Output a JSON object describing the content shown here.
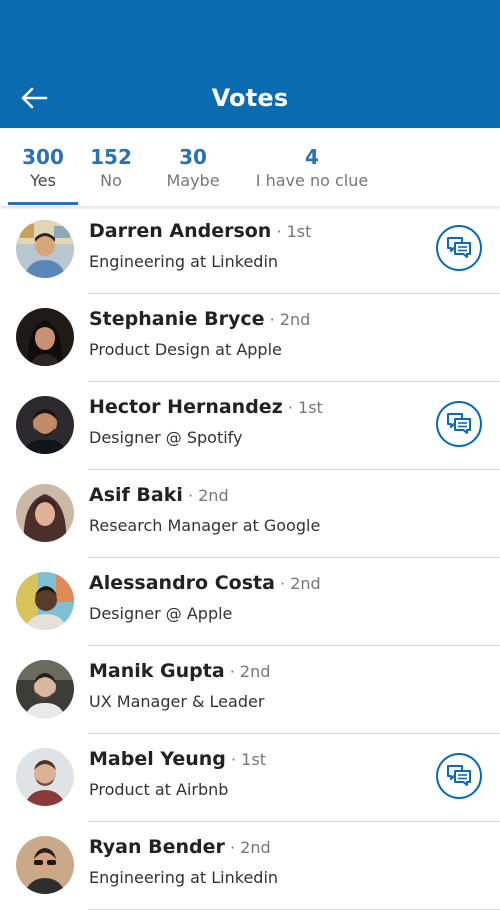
{
  "header": {
    "title": "Votes",
    "back_icon": "arrow-left-icon",
    "bg_color": "#0b6bb0"
  },
  "tabs": [
    {
      "count": "300",
      "label": "Yes",
      "active": true
    },
    {
      "count": "152",
      "label": "No",
      "active": false
    },
    {
      "count": "30",
      "label": "Maybe",
      "active": false
    },
    {
      "count": "4",
      "label": "I have no clue",
      "active": false
    }
  ],
  "voters": [
    {
      "name": "Darren Anderson",
      "degree": "1st",
      "headline": "Engineering at Linkedin",
      "message_icon": true
    },
    {
      "name": "Stephanie Bryce",
      "degree": "2nd",
      "headline": "Product Design at Apple",
      "message_icon": false
    },
    {
      "name": "Hector Hernandez",
      "degree": "1st",
      "headline": "Designer @ Spotify",
      "message_icon": true
    },
    {
      "name": "Asif Baki",
      "degree": "2nd",
      "headline": "Research Manager at Google",
      "message_icon": false
    },
    {
      "name": "Alessandro Costa",
      "degree": "2nd",
      "headline": "Designer @ Apple",
      "message_icon": false
    },
    {
      "name": "Manik Gupta",
      "degree": "2nd",
      "headline": "UX Manager & Leader",
      "message_icon": false
    },
    {
      "name": "Mabel Yeung",
      "degree": "1st",
      "headline": "Product at Airbnb",
      "message_icon": true
    },
    {
      "name": "Ryan Bender",
      "degree": "2nd",
      "headline": "Engineering at Linkedin",
      "message_icon": false
    }
  ],
  "separator": "·",
  "accent_color": "#2a72b0"
}
